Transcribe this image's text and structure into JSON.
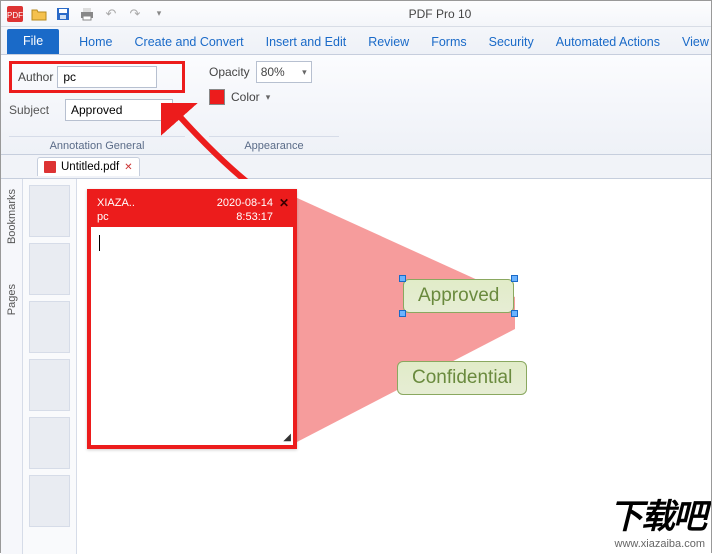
{
  "app": {
    "title": "PDF Pro 10"
  },
  "ribbon": {
    "file": "File",
    "tabs": [
      "Home",
      "Create and Convert",
      "Insert and Edit",
      "Review",
      "Forms",
      "Security",
      "Automated Actions",
      "View"
    ]
  },
  "annotation": {
    "author_label": "Author",
    "author_value": "pc",
    "subject_label": "Subject",
    "subject_value": "Approved",
    "group1_label": "Annotation General",
    "opacity_label": "Opacity",
    "opacity_value": "80%",
    "color_label": "Color",
    "color_value": "#ec1c1c",
    "group2_label": "Appearance"
  },
  "document": {
    "tab_name": "Untitled.pdf"
  },
  "side": {
    "bookmarks": "Bookmarks",
    "pages": "Pages"
  },
  "note": {
    "title": "XIAZA..",
    "author": "pc",
    "date": "2020-08-14",
    "time": "8:53:17",
    "body": ""
  },
  "stamps": {
    "approved": "Approved",
    "confidential": "Confidential"
  },
  "watermark": {
    "text": "下载吧",
    "url": "www.xiazaiba.com"
  }
}
